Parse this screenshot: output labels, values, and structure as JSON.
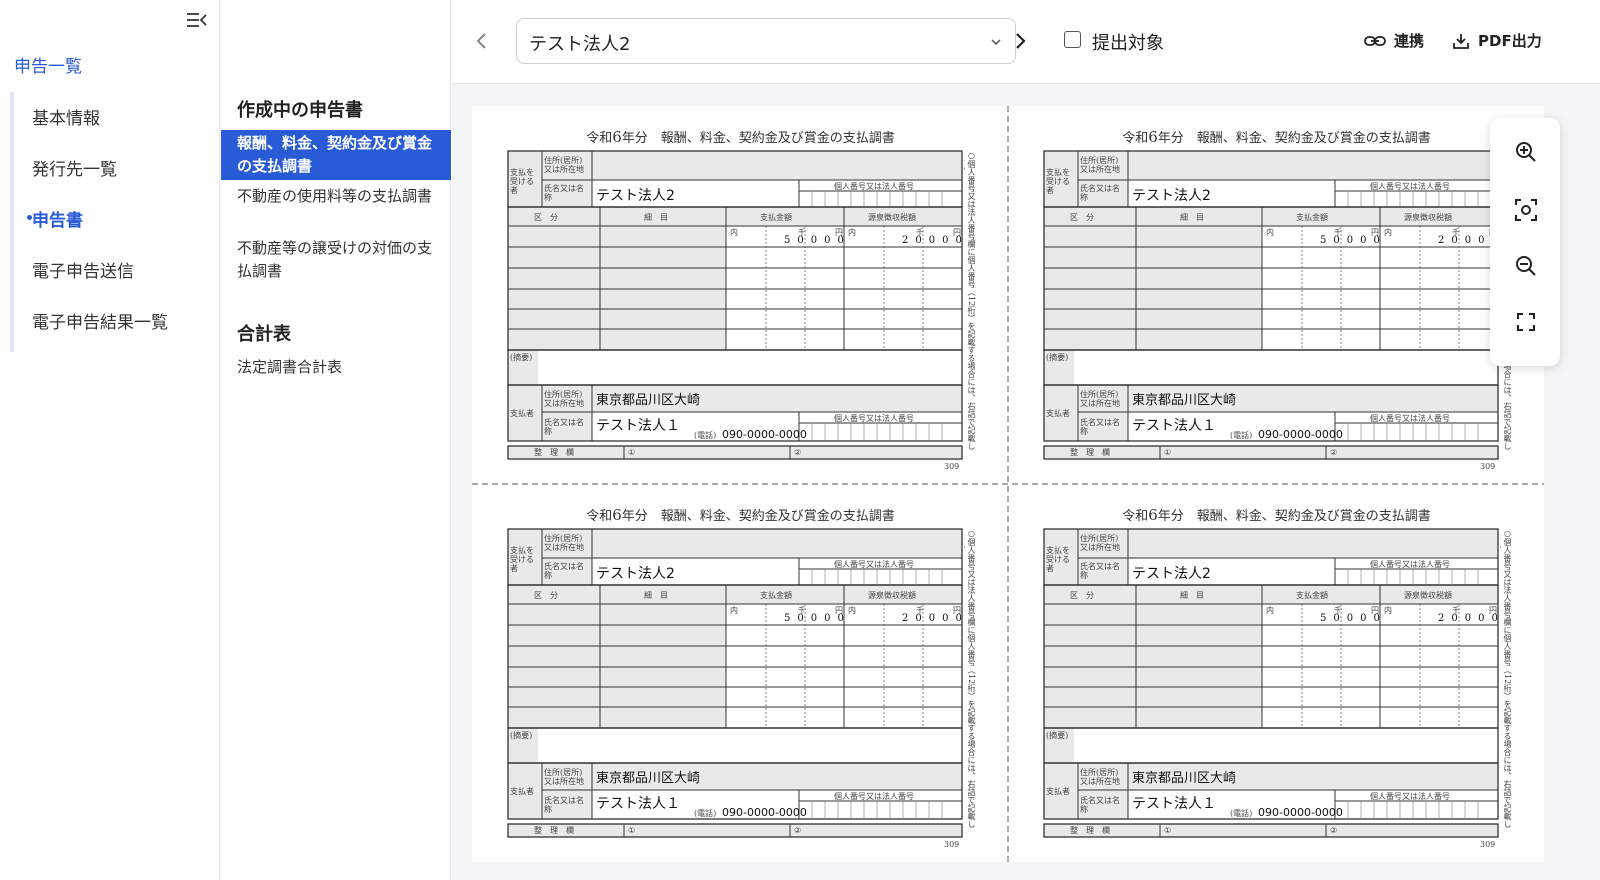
{
  "nav": {
    "title": "申告一覧",
    "items": [
      "基本情報",
      "発行先一覧",
      "申告書",
      "電子申告送信",
      "電子申告結果一覧"
    ],
    "active_index": 2
  },
  "sub": {
    "section1": "作成中の申告書",
    "docs": [
      "報酬、料金、契約金及び賞金の支払調書",
      "不動産の使用料等の支払調書",
      "不動産等の譲受けの対価の支払調書"
    ],
    "selected_index": 0,
    "section2": "合計表",
    "totals": [
      "法定調書合計表"
    ]
  },
  "topbar": {
    "company": "テスト法人2",
    "checkbox_label": "提出対象",
    "checkbox_checked": false,
    "link_label": "連携",
    "pdf_label": "PDF出力"
  },
  "form": {
    "title_prefix": "令和",
    "year": "6",
    "title_suffix": "年分　報酬、料金、契約金及び賞金の支払調書",
    "recv_label": "支払を受ける者",
    "addr_label": "住所(居所)又は所在地",
    "name_label": "氏名又は名称",
    "id_label": "個人番号又は法人番号",
    "col_kubun": "区　分",
    "col_saimoku": "細　目",
    "col_amount": "支払金額",
    "col_tax": "源泉徴収税額",
    "uchi": "内",
    "sen": "千",
    "en": "円",
    "recipient_name": "テスト法人2",
    "amount": "50000",
    "tax": "20000",
    "tekiyo": "(摘要)",
    "payer_label": "支払者",
    "payer_address": "東京都品川区大崎",
    "payer_name": "テスト法人１",
    "phone_label": "(電話)",
    "payer_phone": "090-0000-0000",
    "seiri": "整　理　欄",
    "mark1": "①",
    "mark2": "②",
    "code": "309",
    "side_note": "○個人番号又は法人番号欄に個人番号（12桁）を記載する場合には、右詰で記載します。"
  },
  "tools": [
    "zoom-in-icon",
    "fit-screen-icon",
    "zoom-out-icon",
    "fullscreen-icon"
  ]
}
